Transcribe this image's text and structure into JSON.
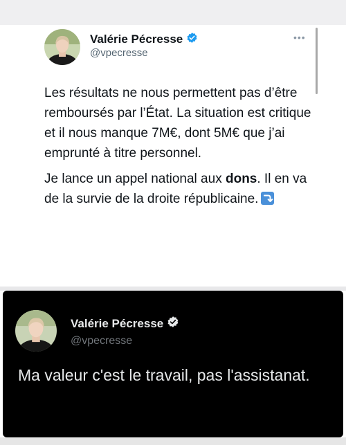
{
  "tweet1": {
    "author_name": "Valérie Pécresse",
    "handle": "@vpecresse",
    "more_label": "•••",
    "paragraph1": "Les résultats ne nous permettent pas d’être remboursés par l’État. La situation est critique et il nous manque 7M€, dont 5M€ que j’ai emprunté à titre personnel.",
    "paragraph2_start": "Je lance un appel national aux ",
    "paragraph2_bold": "dons",
    "paragraph2_end": ". Il en va de la survie de la droite républicaine.",
    "emoji": "right-arrow-curving-down-icon"
  },
  "tweet2": {
    "author_name": "Valérie Pécresse",
    "handle": "@vpecresse",
    "text": "Ma valeur c'est le travail, pas l'assistanat."
  },
  "colors": {
    "verified_light": "#1d9bf0",
    "verified_dark": "#e7e9ea",
    "dark_bg": "#000000",
    "emoji_blue": "#4a90d9"
  }
}
